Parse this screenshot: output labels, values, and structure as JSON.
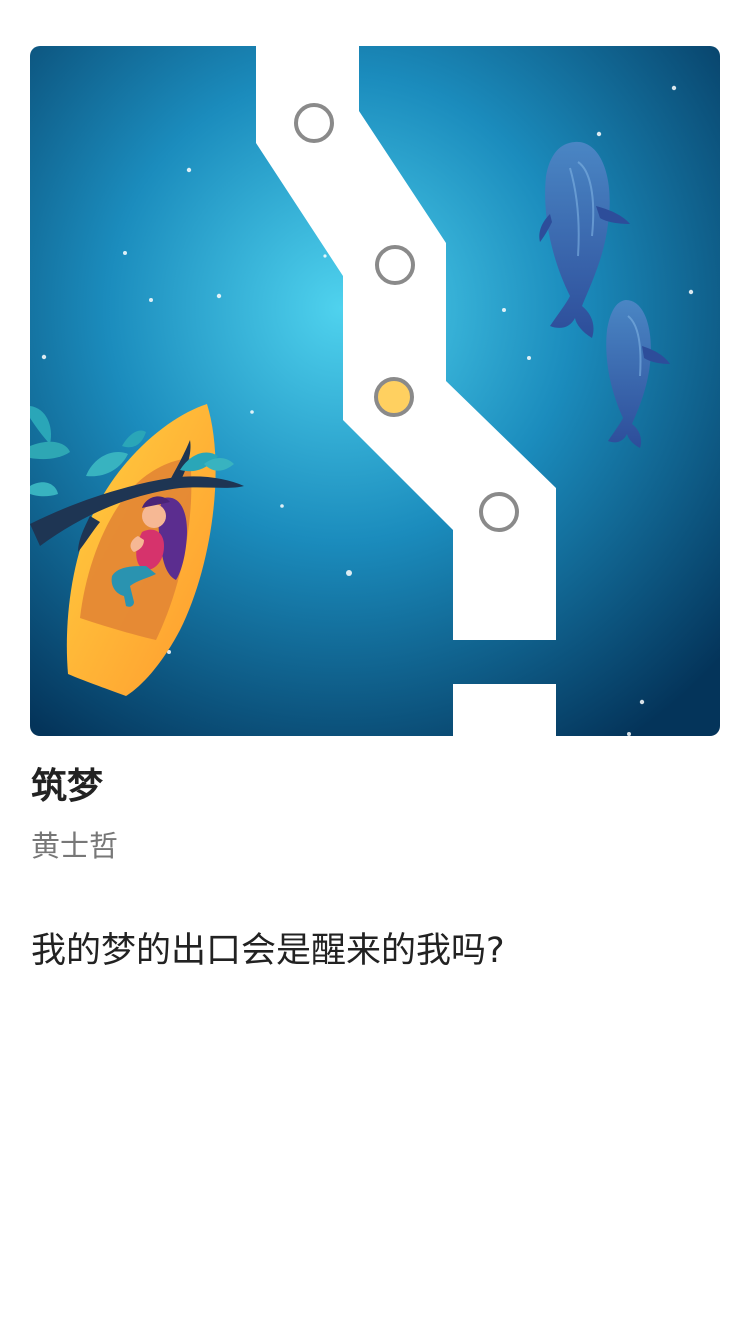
{
  "game": {
    "title": "筑梦",
    "author": "黄士哲",
    "tagline": "我的梦的出口会是醒来的我吗?"
  },
  "colors": {
    "ocean_center": "#4fd2ee",
    "ocean_edge": "#04345a",
    "path": "#ffffff",
    "node_ring": "#8a8a8a",
    "node_active": "#ffd060",
    "boat": "#ffad33"
  },
  "icons": [
    "whale-icon",
    "boat-icon",
    "sleeping-girl-icon",
    "branch-icon",
    "level-node-icon"
  ]
}
